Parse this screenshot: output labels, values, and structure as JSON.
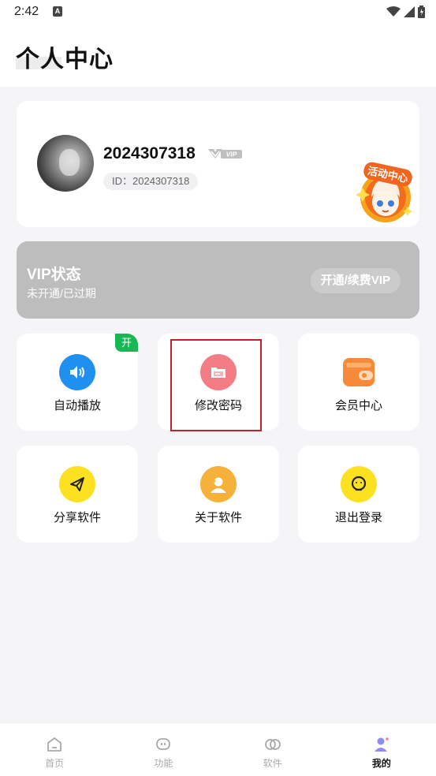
{
  "status_bar": {
    "time": "2:42",
    "notification_icon": "a-icon",
    "icons": [
      "wifi-icon",
      "signal-icon",
      "battery-icon"
    ]
  },
  "header": {
    "title": "个人中心"
  },
  "profile": {
    "username": "2024307318",
    "vip_badge": "VIP",
    "id_text": "ID：2024307318",
    "activity_badge": "活动中心"
  },
  "vip_status": {
    "title": "VIP状态",
    "subtitle": "未开通/已过期",
    "button_label": "开通/续费VIP"
  },
  "grid": [
    {
      "label": "自动播放",
      "icon": "speaker-icon",
      "color": "#1f90f0",
      "tag": "开"
    },
    {
      "label": "修改密码",
      "icon": "folder-icon",
      "color": "#f37c85"
    },
    {
      "label": "会员中心",
      "icon": "wallet-icon",
      "color": "#f6893a"
    },
    {
      "label": "分享软件",
      "icon": "paper-plane-icon",
      "color": "#fbe120"
    },
    {
      "label": "关于软件",
      "icon": "user-icon",
      "color": "#f6b13a"
    },
    {
      "label": "退出登录",
      "icon": "exit-face-icon",
      "color": "#fbe120"
    }
  ],
  "tabbar": [
    {
      "label": "首页",
      "icon": "home-icon"
    },
    {
      "label": "功能",
      "icon": "chat-icon"
    },
    {
      "label": "软件",
      "icon": "apps-icon"
    },
    {
      "label": "我的",
      "icon": "profile-icon",
      "active": true
    }
  ],
  "colors": {
    "accent_green": "#18b755",
    "vip_gray": "#bdbdbd",
    "highlight_red": "#c81e2b"
  }
}
